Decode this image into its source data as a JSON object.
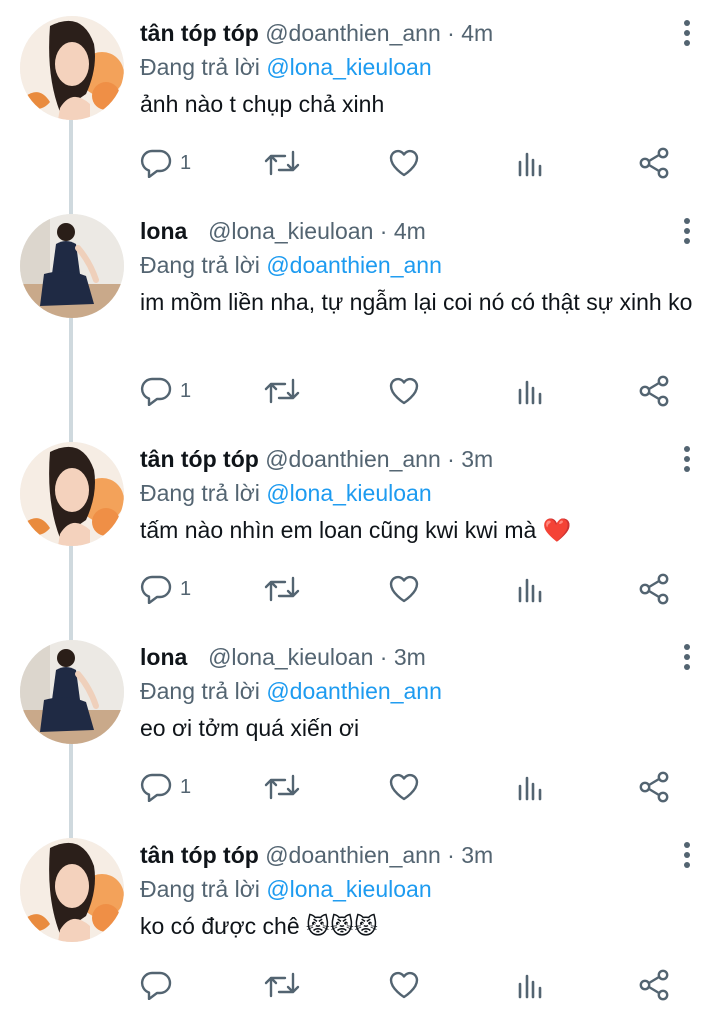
{
  "thread": [
    {
      "name": "tân tóp tóp",
      "handle": "@doanthien_ann",
      "dot": "·",
      "time": "4m",
      "reply_prefix": "Đang trả lời",
      "reply_to": "@lona_kieuloan",
      "text": "ảnh nào t chụp chả xinh",
      "reply_count": "1",
      "avatar": "avatar-orange-flowers"
    },
    {
      "name": "lona",
      "handle": "@lona_kieuloan",
      "dot": "·",
      "time": "4m",
      "reply_prefix": "Đang trả lời",
      "reply_to": "@doanthien_ann",
      "text": "im mồm liền nha, tự ngẫm lại coi nó có thật sự xinh ko",
      "reply_count": "1",
      "avatar": "avatar-navy-dress"
    },
    {
      "name": "tân tóp tóp",
      "handle": "@doanthien_ann",
      "dot": "·",
      "time": "3m",
      "reply_prefix": "Đang trả lời",
      "reply_to": "@lona_kieuloan",
      "text": "tấm nào nhìn em loan cũng kwi kwi mà ❤️",
      "reply_count": "1",
      "avatar": "avatar-orange-flowers"
    },
    {
      "name": "lona",
      "handle": "@lona_kieuloan",
      "dot": "·",
      "time": "3m",
      "reply_prefix": "Đang trả lời",
      "reply_to": "@doanthien_ann",
      "text": "eo ơi tởm quá xiến ơi",
      "reply_count": "1",
      "avatar": "avatar-navy-dress"
    },
    {
      "name": "tân tóp tóp",
      "handle": "@doanthien_ann",
      "dot": "·",
      "time": "3m",
      "reply_prefix": "Đang trả lời",
      "reply_to": "@lona_kieuloan",
      "text": "ko có được chê 😾😾😾",
      "reply_count": "",
      "avatar": "avatar-orange-flowers"
    }
  ],
  "colors": {
    "text": "#0f1419",
    "secondary": "#536471",
    "mention": "#1d9bf0",
    "thread_line": "#cfd9de"
  }
}
